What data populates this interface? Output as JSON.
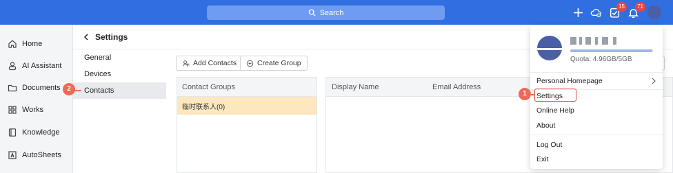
{
  "topbar": {
    "search_label": "Search",
    "tasks_badge": "15",
    "notifications_badge": "71"
  },
  "left_nav": {
    "items": [
      {
        "label": "Home",
        "icon": "home-icon"
      },
      {
        "label": "AI Assistant",
        "icon": "ai-assistant-icon"
      },
      {
        "label": "Documents",
        "icon": "folder-icon"
      },
      {
        "label": "Works",
        "icon": "grid-icon"
      },
      {
        "label": "Knowledge",
        "icon": "book-icon"
      },
      {
        "label": "AutoSheets",
        "icon": "autosheets-icon"
      }
    ]
  },
  "settings": {
    "title": "Settings",
    "menu": [
      {
        "label": "General"
      },
      {
        "label": "Devices"
      },
      {
        "label": "Contacts",
        "active": true
      }
    ]
  },
  "contacts": {
    "add_contacts_label": "Add Contacts",
    "create_group_label": "Create Group",
    "groups_header": "Contact Groups",
    "groups": [
      {
        "label": "临时联系人(0)"
      }
    ],
    "columns": [
      "Display Name",
      "Email Address"
    ]
  },
  "user_menu": {
    "quota_text": "Quota: 4.96GB/5GB",
    "quota_fraction": 0.992,
    "items": [
      {
        "label": "Personal Homepage"
      },
      {
        "label": "Settings"
      },
      {
        "label": "Online Help"
      },
      {
        "label": "About"
      },
      {
        "label": "Log Out"
      },
      {
        "label": "Exit"
      }
    ]
  },
  "annotations": {
    "step1": "1",
    "step2": "2"
  },
  "colors": {
    "brand_blue": "#2f6fe0",
    "highlight_red": "#e0413b",
    "step_orange": "#ef6a55",
    "group_selected": "#fde7bf"
  }
}
